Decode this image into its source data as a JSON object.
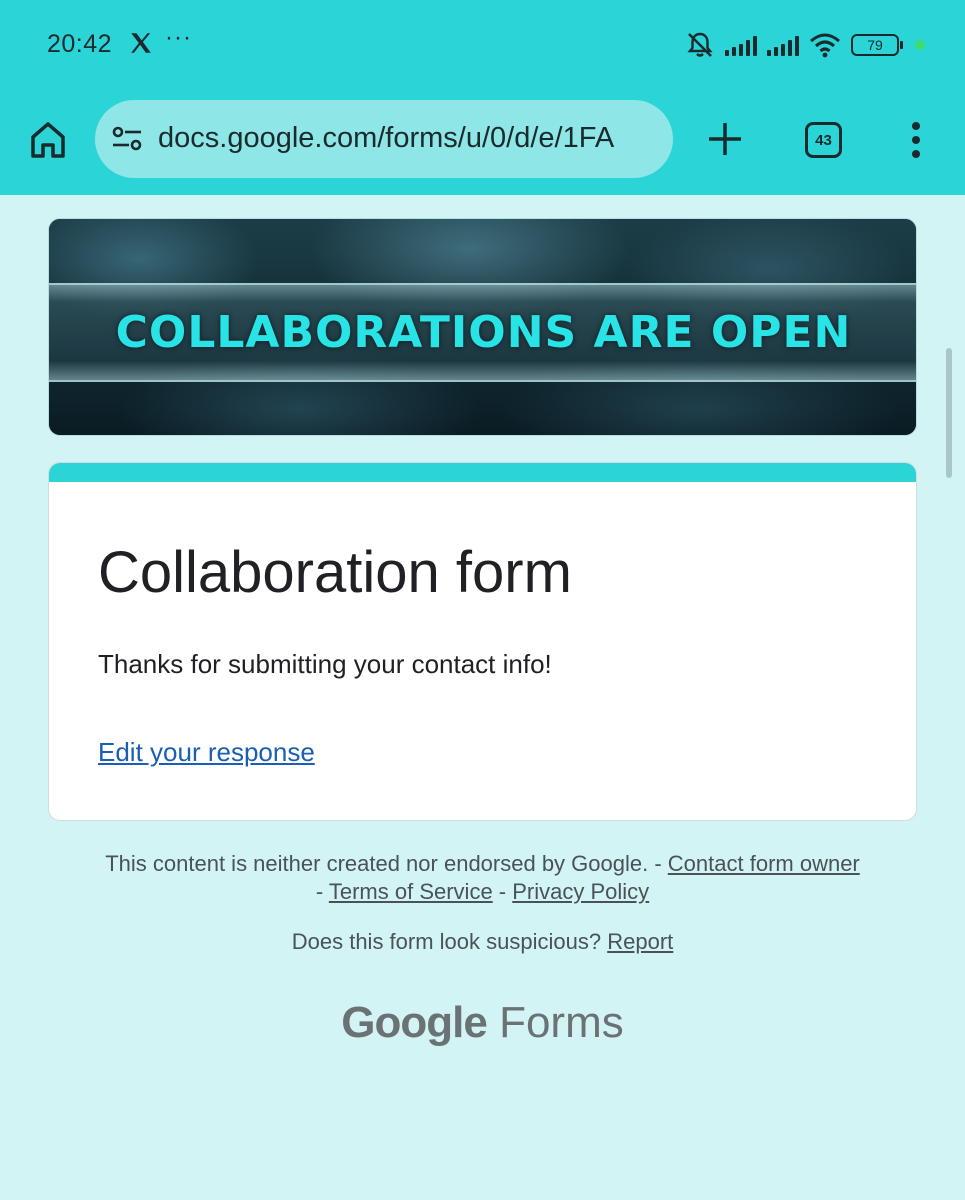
{
  "status_bar": {
    "time": "20:42",
    "more": "···",
    "battery": "79",
    "icons": [
      "x-logo-icon",
      "bell-off-icon",
      "signal-icon",
      "signal-icon",
      "wifi-icon",
      "battery-icon"
    ]
  },
  "browser": {
    "url": "docs.google.com/forms/u/0/d/e/1FA",
    "tab_count": "43"
  },
  "banner": {
    "text": "COLLABORATIONS ARE OPEN"
  },
  "form": {
    "title": "Collaboration form",
    "message": "Thanks for submitting your contact info!",
    "edit_link": "Edit your response",
    "accent_color": "#2bd4d7"
  },
  "footer": {
    "disclaimer_text": "This content is neither created nor endorsed by Google. -",
    "contact_owner": "Contact form owner",
    "sep1": " - ",
    "terms": "Terms of Service",
    "sep2": " - ",
    "privacy": "Privacy Policy",
    "suspicious_text": "Does this form look suspicious?",
    "report": "Report",
    "brand_google": "Google",
    "brand_forms": "Forms"
  }
}
